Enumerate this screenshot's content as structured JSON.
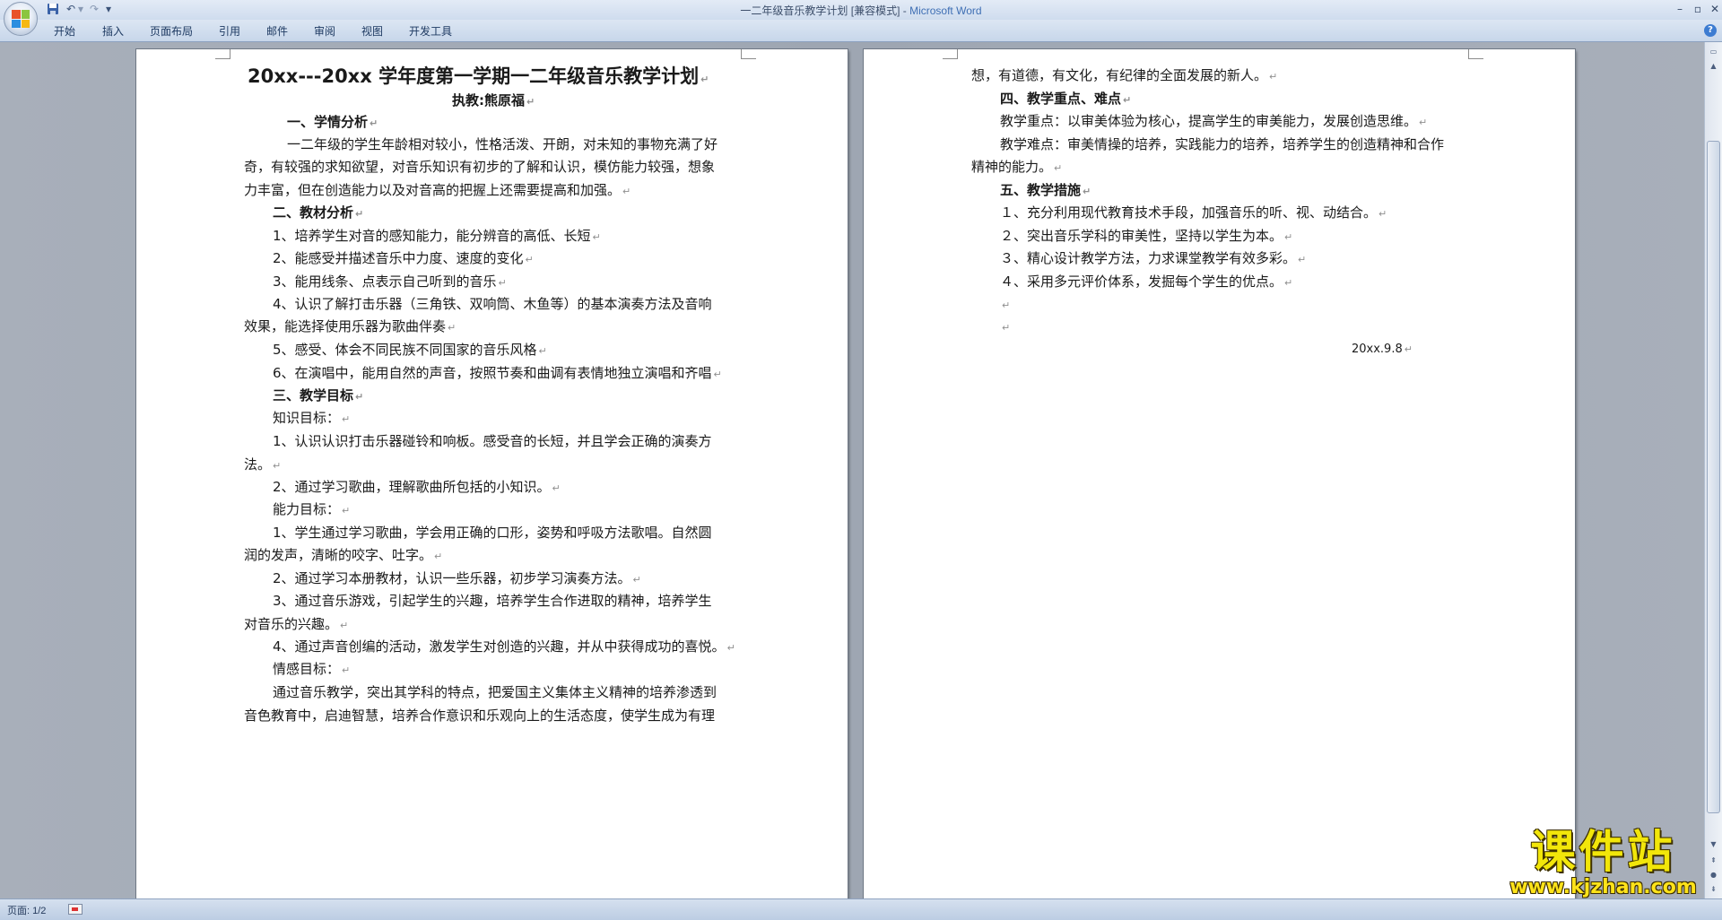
{
  "titlebar": {
    "doc_name": "一二年级音乐教学计划 [兼容模式] - ",
    "app_name": "Microsoft Word"
  },
  "ribbon": {
    "tabs": [
      "开始",
      "插入",
      "页面布局",
      "引用",
      "邮件",
      "审阅",
      "视图",
      "开发工具"
    ]
  },
  "page1": {
    "title": "20xx---20xx 学年度第一学期一二年级音乐教学计划",
    "author": "执教:熊原福",
    "lines": [
      "一、学情分析",
      "一二年级的学生年龄相对较小，性格活泼、开朗，对未知的事物充满了好",
      "奇，有较强的求知欲望，对音乐知识有初步的了解和认识，模仿能力较强，想象",
      "力丰富，但在创造能力以及对音高的把握上还需要提高和加强。",
      "二、教材分析",
      "1、培养学生对音的感知能力，能分辨音的高低、长短",
      "2、能感受并描述音乐中力度、速度的变化",
      "3、能用线条、点表示自己听到的音乐",
      "4、认识了解打击乐器（三角铁、双响筒、木鱼等）的基本演奏方法及音响",
      "效果，能选择使用乐器为歌曲伴奏",
      "5、感受、体会不同民族不同国家的音乐风格",
      "6、在演唱中，能用自然的声音，按照节奏和曲调有表情地独立演唱和齐唱",
      "三、教学目标",
      "知识目标：",
      "1、认识认识打击乐器碰铃和响板。感受音的长短，并且学会正确的演奏方",
      "法。",
      "2、通过学习歌曲，理解歌曲所包括的小知识。",
      "能力目标：",
      "1、学生通过学习歌曲，学会用正确的口形，姿势和呼吸方法歌唱。自然圆",
      "润的发声，清晰的咬字、吐字。",
      "2、通过学习本册教材，认识一些乐器，初步学习演奏方法。",
      "3、通过音乐游戏，引起学生的兴趣，培养学生合作进取的精神，培养学生",
      "对音乐的兴趣。",
      "4、通过声音创编的活动，激发学生对创造的兴趣，并从中获得成功的喜悦。",
      "情感目标：",
      "通过音乐教学，突出其学科的特点，把爱国主义集体主义精神的培养渗透到",
      "音色教育中，启迪智慧，培养合作意识和乐观向上的生活态度，使学生成为有理"
    ]
  },
  "page2": {
    "lines": [
      "想，有道德，有文化，有纪律的全面发展的新人。",
      "四、教学重点、难点",
      "教学重点：以审美体验为核心，提高学生的审美能力，发展创造思维。",
      "教学难点：审美情操的培养，实践能力的培养，培养学生的创造精神和合作",
      "精神的能力。",
      "五、教学措施",
      "１、充分利用现代教育技术手段，加强音乐的听、视、动结合。",
      "２、突出音乐学科的审美性，坚持以学生为本。",
      "３、精心设计教学方法，力求课堂教学有效多彩。",
      "４、采用多元评价体系，发掘每个学生的优点。",
      "",
      "",
      "20xx.9.8"
    ]
  },
  "status": {
    "page_info": "页面: 1/2"
  },
  "watermark": {
    "big": "课件站",
    "small": "www.kjzhan.com"
  }
}
